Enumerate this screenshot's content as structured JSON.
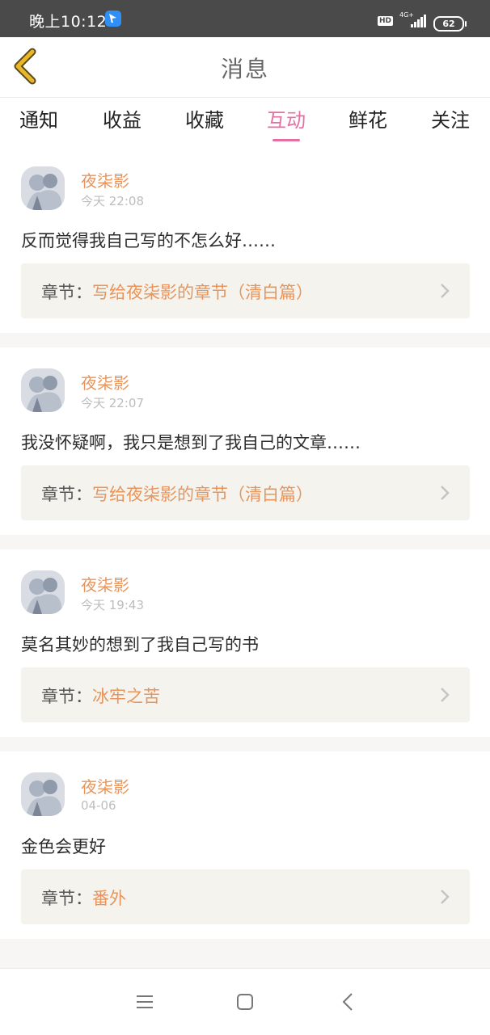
{
  "status_bar": {
    "time": "晚上10:12",
    "hd": "HD",
    "network": "4G+",
    "battery": "62"
  },
  "header": {
    "title": "消息"
  },
  "tabs": [
    {
      "label": "通知",
      "active": false
    },
    {
      "label": "收益",
      "active": false
    },
    {
      "label": "收藏",
      "active": false
    },
    {
      "label": "互动",
      "active": true
    },
    {
      "label": "鲜花",
      "active": false
    },
    {
      "label": "关注",
      "active": false
    }
  ],
  "messages": [
    {
      "name": "夜柒影",
      "time": "今天 22:08",
      "content": "反而觉得我自己写的不怎么好……",
      "chapter_label": "章节：",
      "chapter_title": "写给夜柒影的章节（清白篇）"
    },
    {
      "name": "夜柒影",
      "time": "今天 22:07",
      "content": "我没怀疑啊，我只是想到了我自己的文章……",
      "chapter_label": "章节：",
      "chapter_title": "写给夜柒影的章节（清白篇）"
    },
    {
      "name": "夜柒影",
      "time": "今天 19:43",
      "content": "莫名其妙的想到了我自己写的书",
      "chapter_label": "章节：",
      "chapter_title": "冰牢之苦"
    },
    {
      "name": "夜柒影",
      "time": "04-06",
      "content": "金色会更好",
      "chapter_label": "章节：",
      "chapter_title": "番外"
    }
  ],
  "colors": {
    "accent_pink": "#e56fa1",
    "name_orange": "#e8945a",
    "back_arrow_yellow": "#e9b728"
  },
  "nav_icons": [
    "menu-icon",
    "home-square-icon",
    "back-triangle-icon"
  ]
}
